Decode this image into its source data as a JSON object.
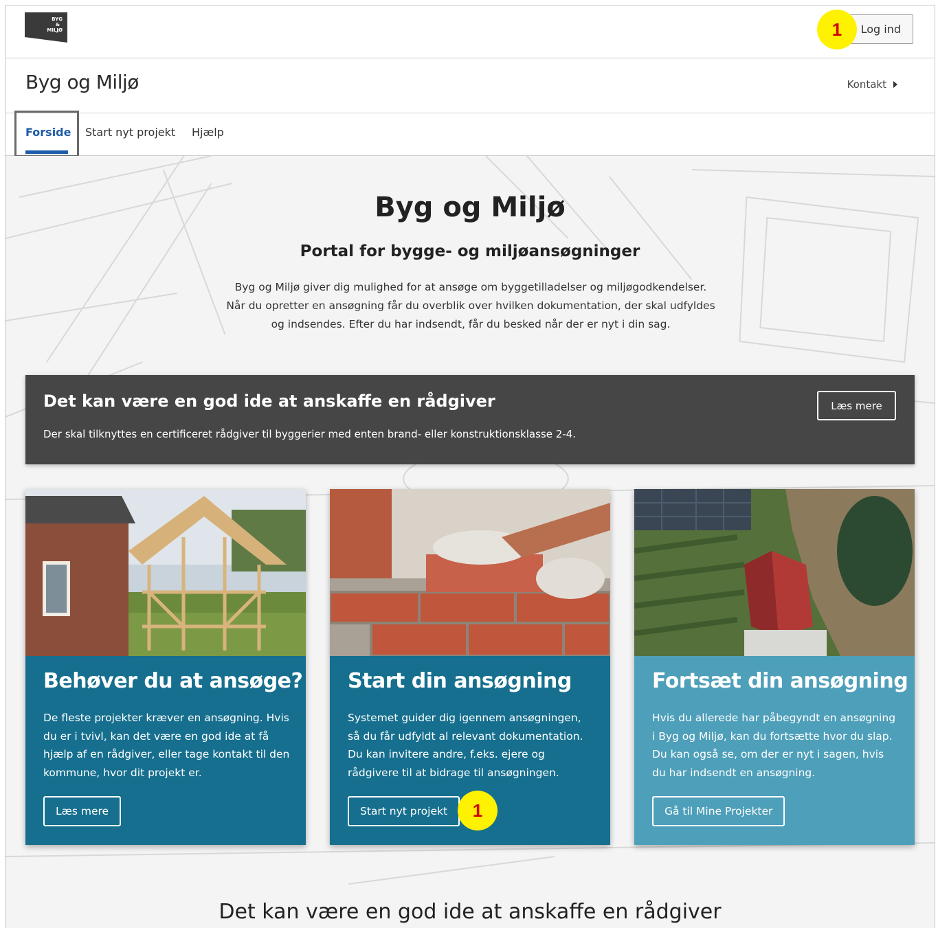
{
  "header": {
    "logo_text": [
      "BYG",
      "&",
      "MILJØ"
    ],
    "login_label": "Log ind",
    "annotation_badge": "1"
  },
  "titlebar": {
    "site_title": "Byg og Miljø",
    "contact_label": "Kontakt"
  },
  "nav": {
    "tabs": [
      {
        "label": "Forside",
        "active": true
      },
      {
        "label": "Start nyt projekt",
        "active": false
      },
      {
        "label": "Hjælp",
        "active": false
      }
    ]
  },
  "hero": {
    "title": "Byg og Miljø",
    "subtitle": "Portal for bygge- og miljøansøgninger",
    "description": "Byg og Miljø giver dig mulighed for at ansøge om byggetilladelser og miljøgodkendelser. Når du opretter en ansøgning får du overblik over hvilken dokumentation, der skal udfyldes og indsendes. Efter du har indsendt, får du besked når der er nyt i din sag."
  },
  "banner": {
    "title": "Det kan være en god ide at anskaffe en rådgiver",
    "text": "Der skal tilknyttes en certificeret rådgiver til byggerier med enten brand- eller konstruktionsklasse 2-4.",
    "button_label": "Læs mere"
  },
  "cards": [
    {
      "title": "Behøver du at ansøge?",
      "text": "De fleste projekter kræver en ansøgning. Hvis du er i tvivl, kan det være en god ide at få hjælp af en rådgiver, eller tage kontakt til den kommune, hvor dit projekt er.",
      "button_label": "Læs mere"
    },
    {
      "title": "Start din ansøgning",
      "text": "Systemet guider dig igennem ansøgningen, så du får udfyldt al relevant dokumentation. Du kan invitere andre, f.eks. ejere og rådgivere til at bidrage til ansøgningen.",
      "button_label": "Start nyt projekt",
      "annotation_badge": "1"
    },
    {
      "title": "Fortsæt din ansøgning",
      "text": "Hvis du allerede har påbegyndt en ansøgning i Byg og Miljø, kan du fortsætte hvor du slap. Du kan også se, om der er nyt i sagen, hvis du har indsendt en ansøgning.",
      "button_label": "Gå til Mine Projekter"
    }
  ],
  "bottom": {
    "heading": "Det kan være en god ide at anskaffe en rådgiver"
  },
  "colors": {
    "nav_active": "#1e5ba8",
    "banner_bg": "#464646",
    "card_teal": "#166f8e",
    "card_light_teal": "#4e9fb9",
    "badge_yellow": "#fff200",
    "badge_red": "#d10000"
  }
}
